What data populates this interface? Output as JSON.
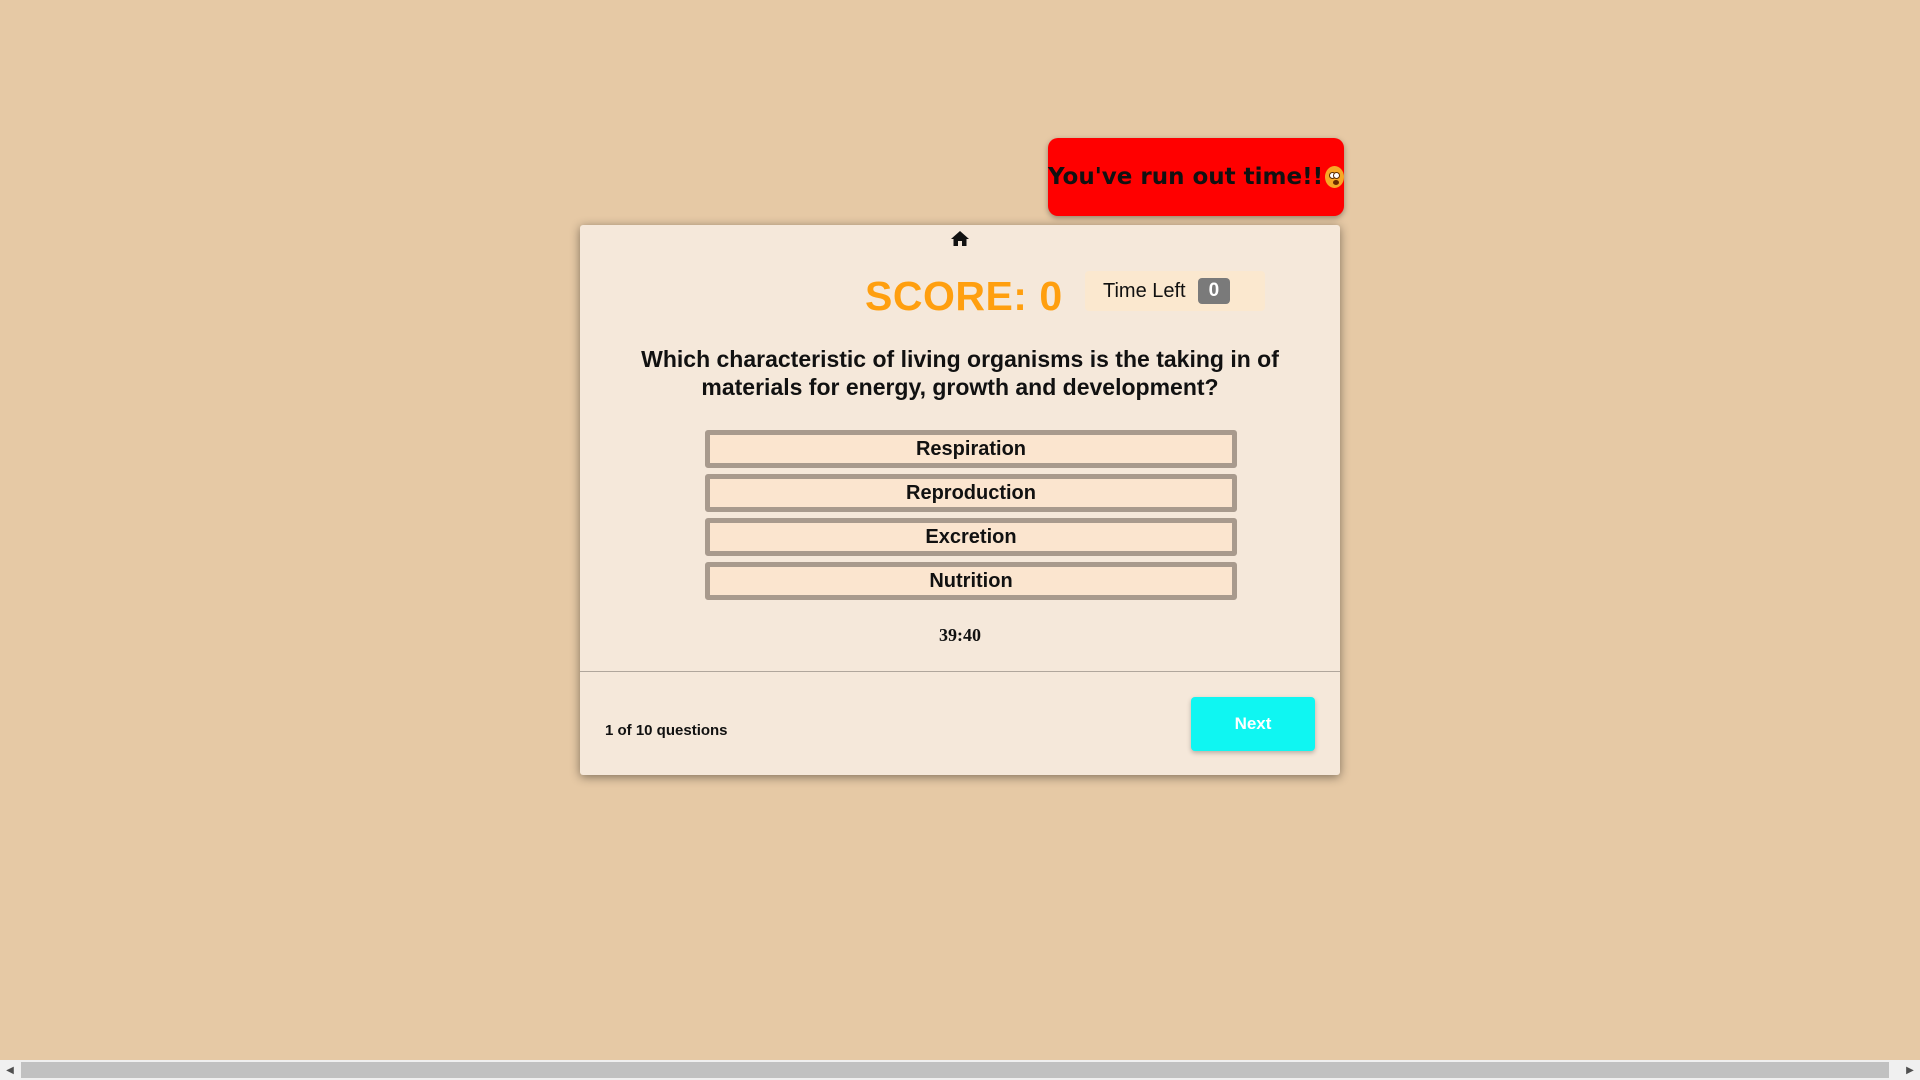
{
  "toast": {
    "message": "You've run out time!!",
    "emoji_icon": "astonished-face-emoji",
    "background": "#ff0000"
  },
  "header": {
    "home_icon": "home-icon",
    "score_label": "SCORE: 0",
    "time_left_label": "Time Left",
    "time_left_value": "0"
  },
  "question": {
    "text": "Which characteristic of living organisms is the taking in of materials for energy, growth and development?"
  },
  "options": [
    "Respiration",
    "Reproduction",
    "Excretion",
    "Nutrition"
  ],
  "timer": "39:40",
  "footer": {
    "counter": "1 of 10 questions",
    "next_label": "Next"
  },
  "colors": {
    "background": "#e6c9a5",
    "card": "#f5e8da",
    "score": "#ff9f0f",
    "next_button": "#0ff6f2"
  }
}
